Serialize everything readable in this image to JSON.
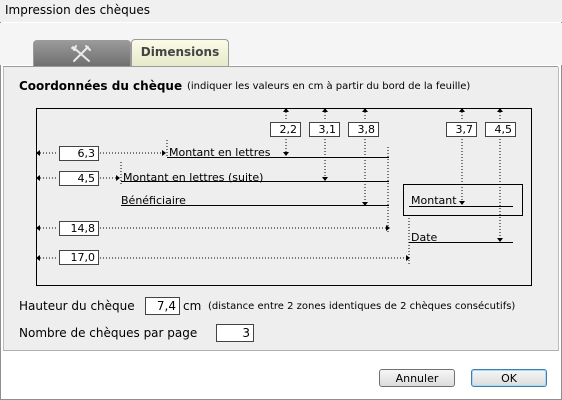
{
  "window": {
    "title": "Impression des chèques"
  },
  "tabs": [
    {
      "icon": "settings-tools-icon",
      "label": ""
    },
    {
      "label": "Dimensions"
    }
  ],
  "section": {
    "heading": "Coordonnées du chèque",
    "hint": "(indiquer les valeurs en cm à partir du bord de la feuille)"
  },
  "fields": {
    "left_offsets": [
      "6,3",
      "4,5",
      "14,8",
      "17,0"
    ],
    "top_offsets": [
      "2,2",
      "3,1",
      "3,8",
      "3,7",
      "4,5"
    ]
  },
  "check_labels": {
    "montant_lettres": "Montant en lettres",
    "montant_lettres_suite": "Montant en lettres (suite)",
    "beneficiaire": "Bénéficiaire",
    "montant": "Montant",
    "date": "Date"
  },
  "hauteur": {
    "label": "Hauteur du chèque",
    "value": "7,4",
    "unit": "cm",
    "hint": "(distance entre 2 zones identiques de 2 chèques consécutifs)"
  },
  "par_page": {
    "label": "Nombre de chèques par page",
    "value": "3"
  },
  "buttons": {
    "cancel": "Annuler",
    "ok": "OK"
  }
}
